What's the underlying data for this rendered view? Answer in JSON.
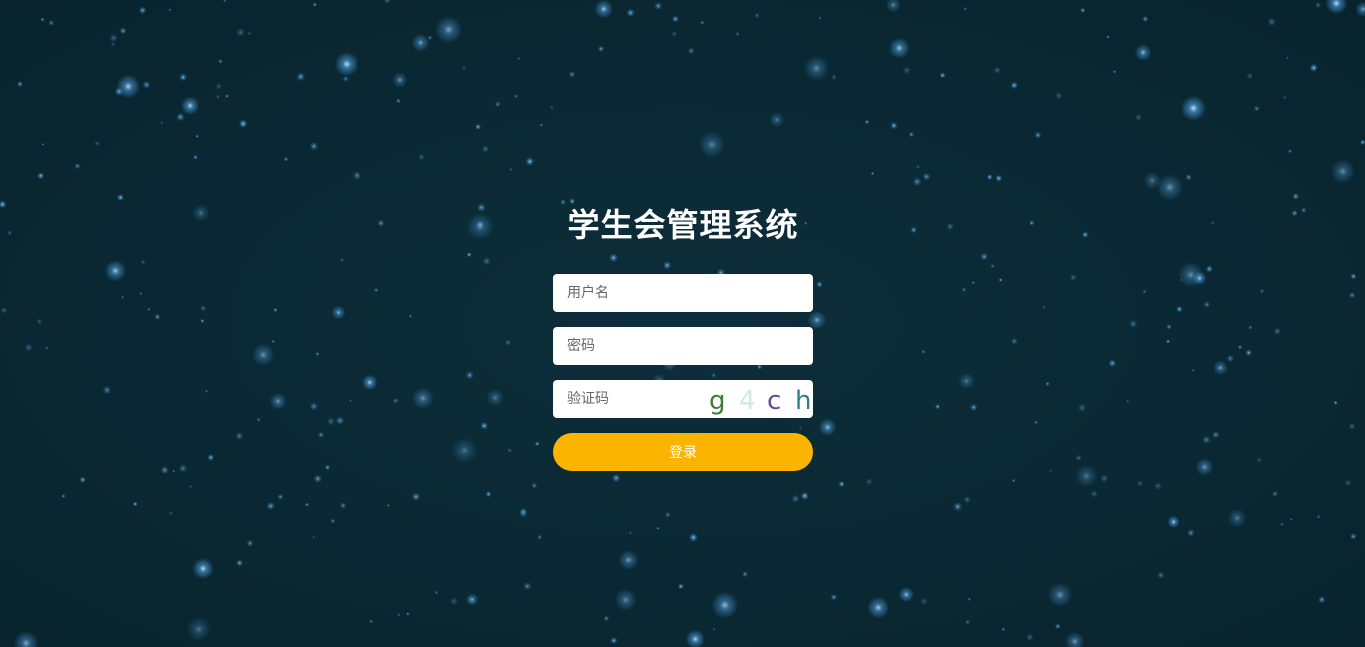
{
  "app": {
    "title": "学生会管理系统"
  },
  "form": {
    "username_placeholder": "用户名",
    "password_placeholder": "密码",
    "captcha_placeholder": "验证码",
    "captcha_chars": [
      "g",
      "4",
      "c",
      "h"
    ],
    "captcha_colors": [
      "#3b7d3a",
      "#cfe9e2",
      "#6a4a9a",
      "#2f7f86"
    ],
    "login_label": "登录"
  },
  "theme": {
    "background": "#0b2a36",
    "button": "#fbb400",
    "star": "#58b6ff"
  }
}
